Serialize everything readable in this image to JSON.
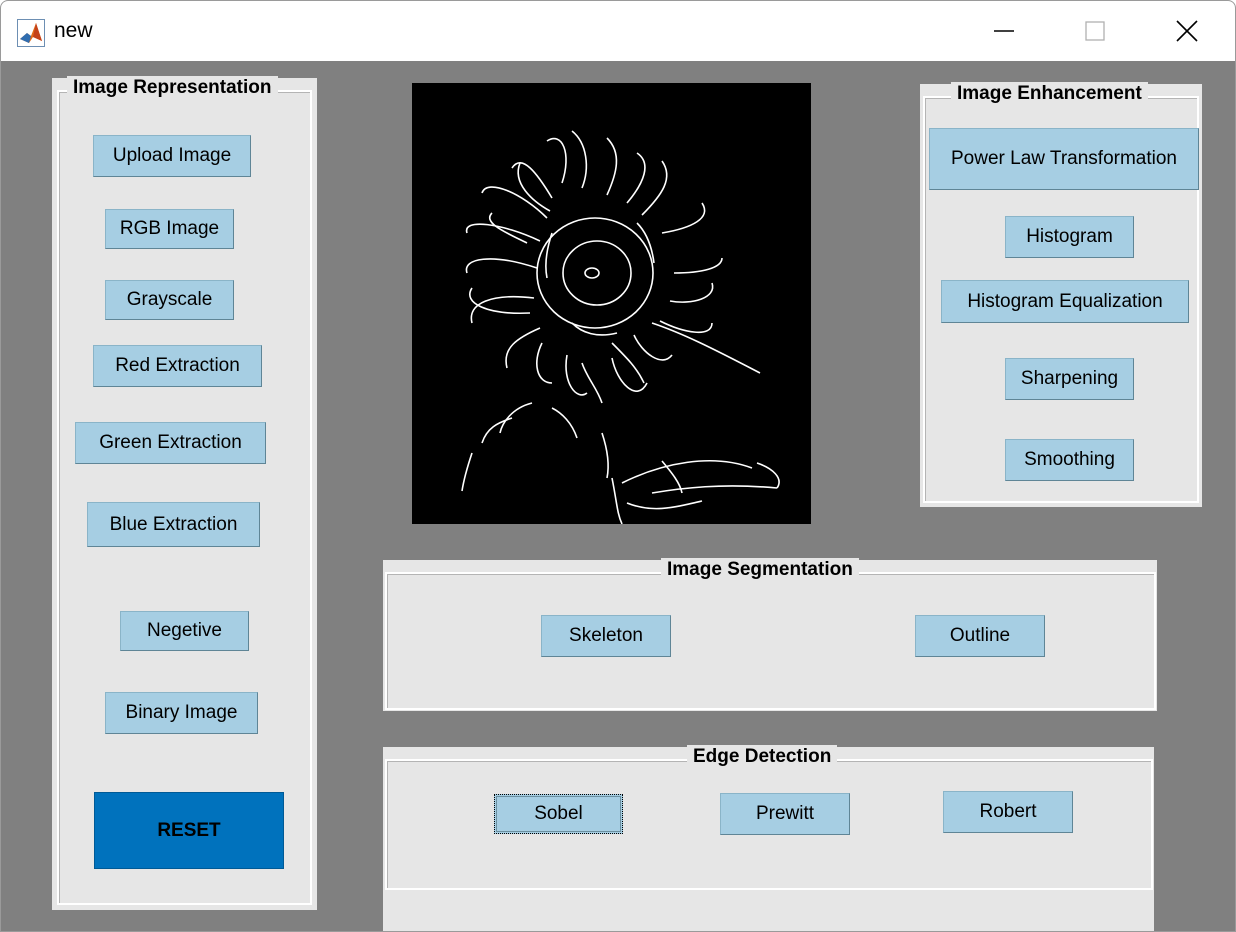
{
  "window": {
    "title": "new",
    "controls": {
      "minimize": "—",
      "maximize": "☐",
      "close": "✕"
    }
  },
  "panels": {
    "representation": {
      "title": "Image Representation",
      "buttons": [
        "Upload Image",
        "RGB Image",
        "Grayscale",
        "Red Extraction",
        "Green Extraction",
        "Blue Extraction",
        "Negetive",
        "Binary Image"
      ],
      "reset": "RESET"
    },
    "enhancement": {
      "title": "Image Enhancement",
      "buttons": [
        "Power Law Transformation",
        "Histogram",
        "Histogram Equalization",
        "Sharpening",
        "Smoothing"
      ]
    },
    "segmentation": {
      "title": "Image Segmentation",
      "buttons": [
        "Skeleton",
        "Outline"
      ]
    },
    "edge": {
      "title": "Edge Detection",
      "buttons": [
        "Sobel",
        "Prewitt",
        "Robert"
      ]
    }
  },
  "image_display": {
    "content": "edge-detected sunflower",
    "background": "#000000",
    "stroke": "#ffffff"
  },
  "colors": {
    "background": "#808080",
    "panel": "#e6e6e6",
    "button": "#a6cee3",
    "reset": "#0072bd"
  }
}
